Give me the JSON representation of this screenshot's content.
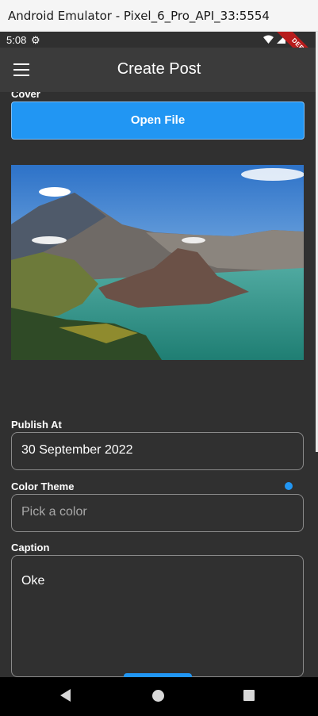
{
  "window": {
    "title": "Android Emulator - Pixel_6_Pro_API_33:5554"
  },
  "statusbar": {
    "time": "5:08",
    "debug_label": "DEBUG"
  },
  "appbar": {
    "title": "Create Post"
  },
  "form": {
    "cover_label": "Cover",
    "open_file_label": "Open File",
    "publish_at_label": "Publish At",
    "publish_at_value": "30 September 2022",
    "color_theme_label": "Color Theme",
    "color_theme_placeholder": "Pick a color",
    "color_theme_color": "#2196f3",
    "caption_label": "Caption",
    "caption_value": "Oke"
  },
  "icons": {
    "menu": "hamburger-menu-icon",
    "settings": "gear-icon",
    "wifi": "wifi-icon",
    "signal": "cellular-signal-icon",
    "battery": "battery-icon",
    "back": "back-icon",
    "home": "home-icon",
    "recents": "recents-icon"
  },
  "colors": {
    "accent": "#2196f3",
    "background": "#303030",
    "appbar": "#3b3b3b"
  }
}
